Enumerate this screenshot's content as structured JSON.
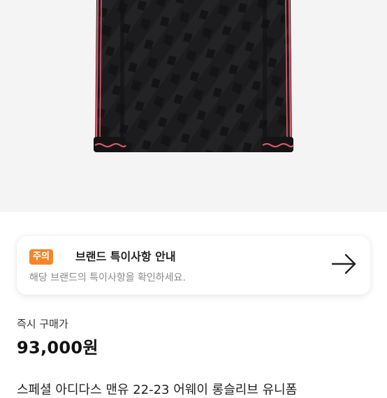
{
  "product": {
    "image_alt": "long-sleeve black jersey",
    "image_icon": "jersey-image",
    "cut_text": "스페셜 아디다스 맨유 22-23 어웨이 롱슬리브 유니폼"
  },
  "notice": {
    "badge": "주의",
    "title": "브랜드 특이사항 안내",
    "subtitle": "해당 브랜드의 특이사항을 확인하세요.",
    "arrow_icon": "arrow-right-icon",
    "badge_color": "#f4852a"
  },
  "price": {
    "label": "즉시 구매가",
    "value": "93,000원"
  }
}
